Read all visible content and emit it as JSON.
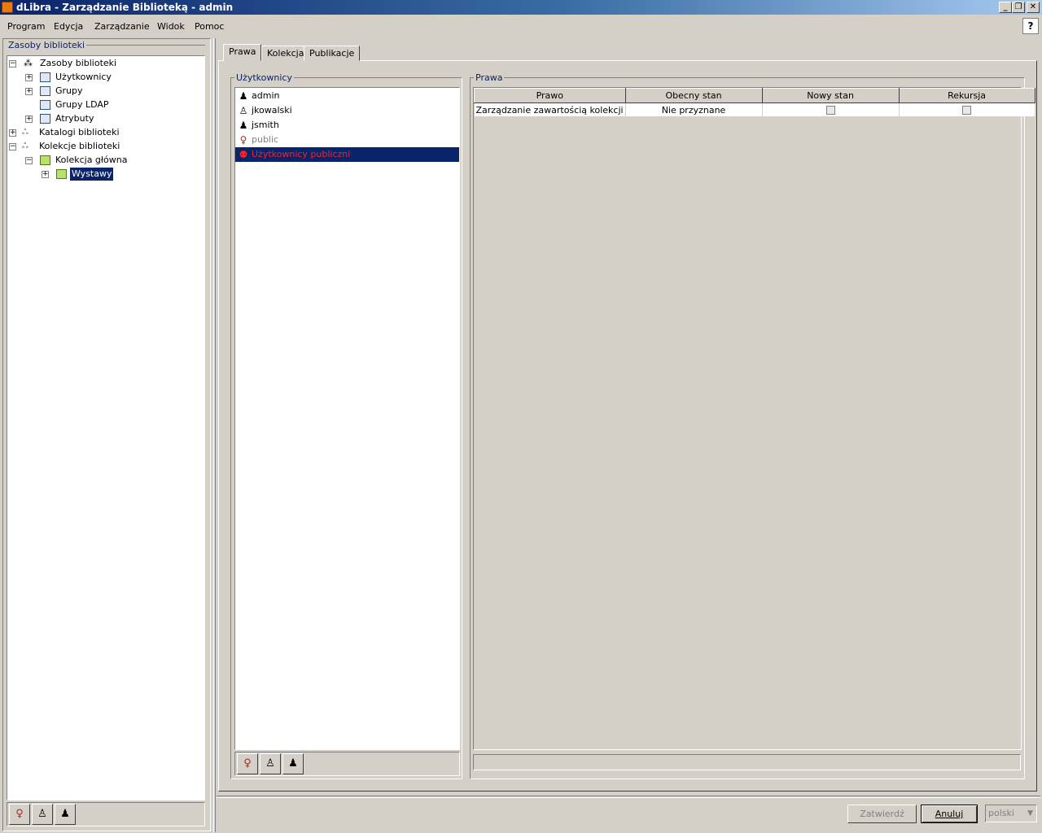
{
  "window": {
    "title": "dLibra - Zarządzanie Biblioteką - admin",
    "controls": {
      "minimize": "_",
      "restore": "❐",
      "close": "✕"
    }
  },
  "menu": [
    "Program",
    "Edycja",
    "Zarządzanie",
    "Widok",
    "Pomoc"
  ],
  "help_button": "?",
  "left_panel": {
    "title": "Zasoby biblioteki",
    "tree": [
      {
        "label": "Zasoby biblioteki",
        "icon": "network-icon",
        "expanded": true
      },
      {
        "label": "Użytkownicy",
        "icon": "users-icon",
        "expanded": false
      },
      {
        "label": "Grupy",
        "icon": "groups-icon",
        "expanded": false
      },
      {
        "label": "Grupy LDAP",
        "icon": "ldap-groups-icon",
        "expanded": null
      },
      {
        "label": "Atrybuty",
        "icon": "attributes-icon",
        "expanded": false
      },
      {
        "label": "Katalogi biblioteki",
        "icon": "catalogs-icon",
        "expanded": false
      },
      {
        "label": "Kolekcje biblioteki",
        "icon": "collections-icon",
        "expanded": true
      },
      {
        "label": "Kolekcja główna",
        "icon": "folder-icon",
        "expanded": true
      },
      {
        "label": "Wystawy",
        "icon": "folder-icon",
        "expanded": false,
        "selected": true
      }
    ],
    "toolbar": [
      "public-user-icon",
      "user-icon",
      "group-icon"
    ]
  },
  "tabs": [
    "Prawa",
    "Kolekcja",
    "Publikacje"
  ],
  "active_tab": "Prawa",
  "users_panel": {
    "title": "Użytkownicy",
    "users": [
      {
        "label": "admin",
        "icon": "group-icon",
        "state": "normal"
      },
      {
        "label": "jkowalski",
        "icon": "user-icon",
        "state": "normal"
      },
      {
        "label": "jsmith",
        "icon": "group-icon",
        "state": "normal"
      },
      {
        "label": "public",
        "icon": "public-user-icon",
        "state": "disabled"
      },
      {
        "label": "Użytkownicy publiczni",
        "icon": "public-group-icon",
        "state": "selected"
      }
    ],
    "toolbar": [
      "public-user-icon",
      "user-icon",
      "group-icon"
    ]
  },
  "rights_panel": {
    "title": "Prawa",
    "columns": [
      "Prawo",
      "Obecny stan",
      "Nowy stan",
      "Rekursja"
    ],
    "rows": [
      {
        "right": "Zarządzanie zawartością kolekcji",
        "current": "Nie przyznane",
        "new_state": false,
        "recursion": false
      }
    ]
  },
  "buttons": {
    "confirm": "Zatwierdź",
    "cancel": "Anuluj"
  },
  "language": "polski",
  "colors": {
    "selection": "#0a246a",
    "selected_user_text": "#ff0000",
    "folder": "#b8e06a",
    "group_title": "#0a246a"
  }
}
